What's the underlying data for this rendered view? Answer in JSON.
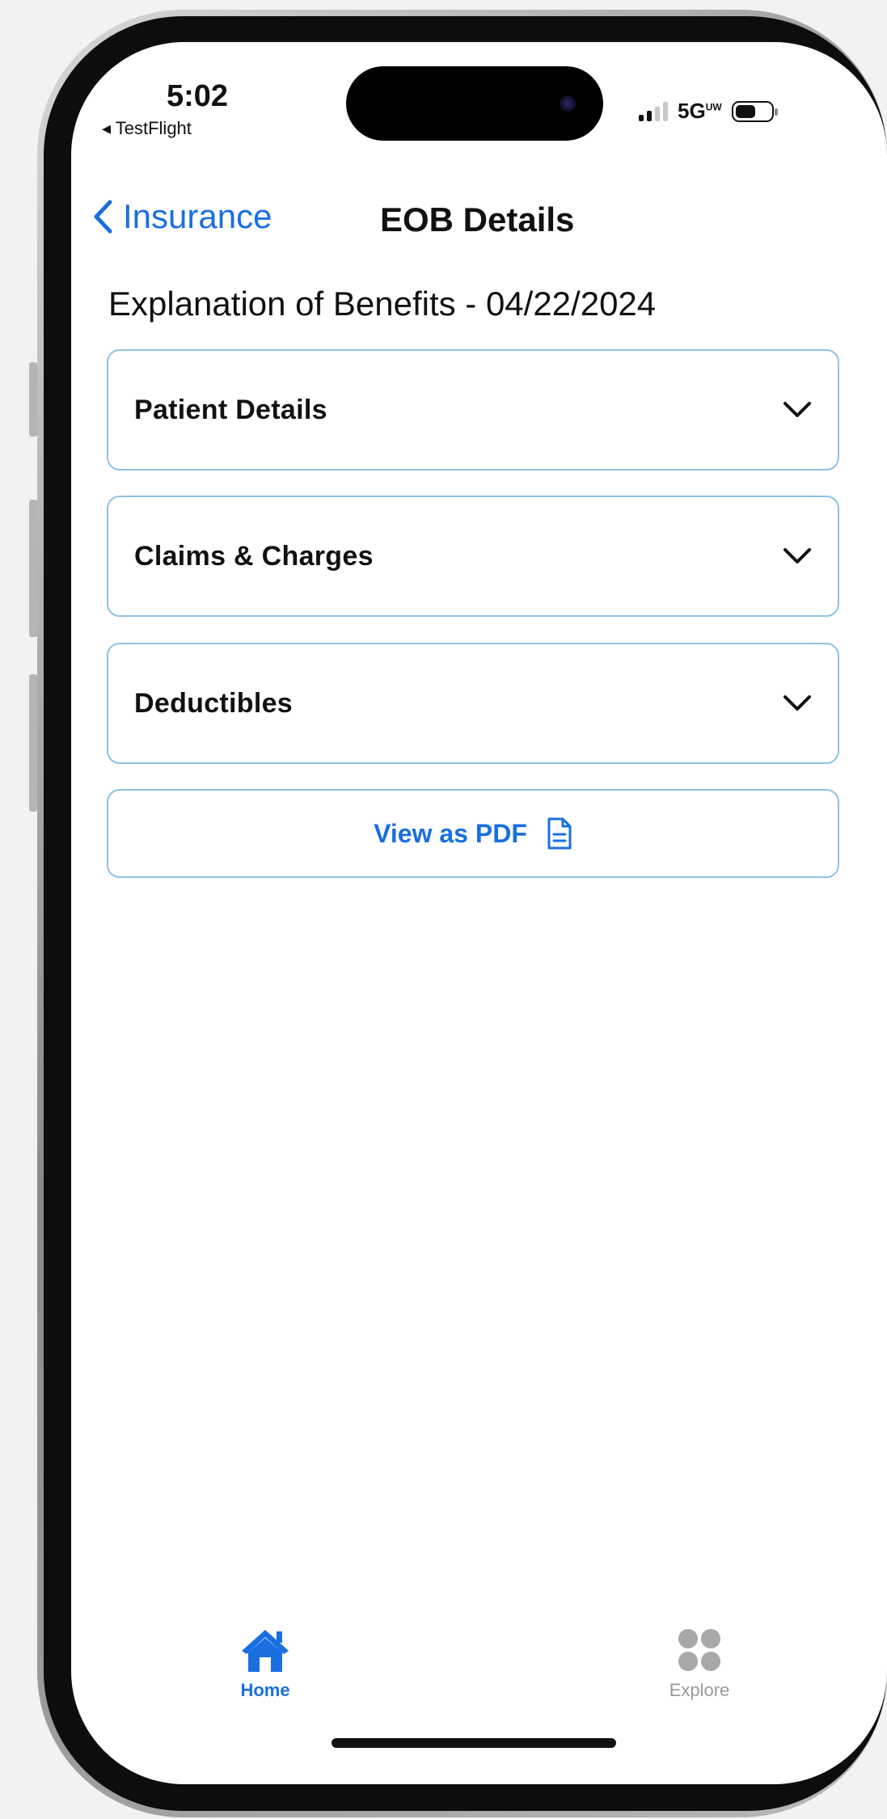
{
  "status_bar": {
    "time": "5:02",
    "back_app": "◂ TestFlight",
    "network": "5G",
    "network_sup": "UW",
    "icons": [
      "signal-icon",
      "battery-icon"
    ]
  },
  "nav": {
    "back_label": "Insurance",
    "title": "EOB Details"
  },
  "page": {
    "heading": "Explanation of Benefits - 04/22/2024"
  },
  "sections": [
    {
      "label": "Patient Details"
    },
    {
      "label": "Claims & Charges"
    },
    {
      "label": "Deductibles"
    }
  ],
  "pdf_button": {
    "label": "View as PDF",
    "icon": "document-icon"
  },
  "tab_bar": {
    "home_label": "Home",
    "explore_label": "Explore",
    "selected": "Home"
  },
  "colors": {
    "accent": "#1a6fe0",
    "card_border": "#8ec2e4",
    "inactive": "#9a9a9a"
  }
}
